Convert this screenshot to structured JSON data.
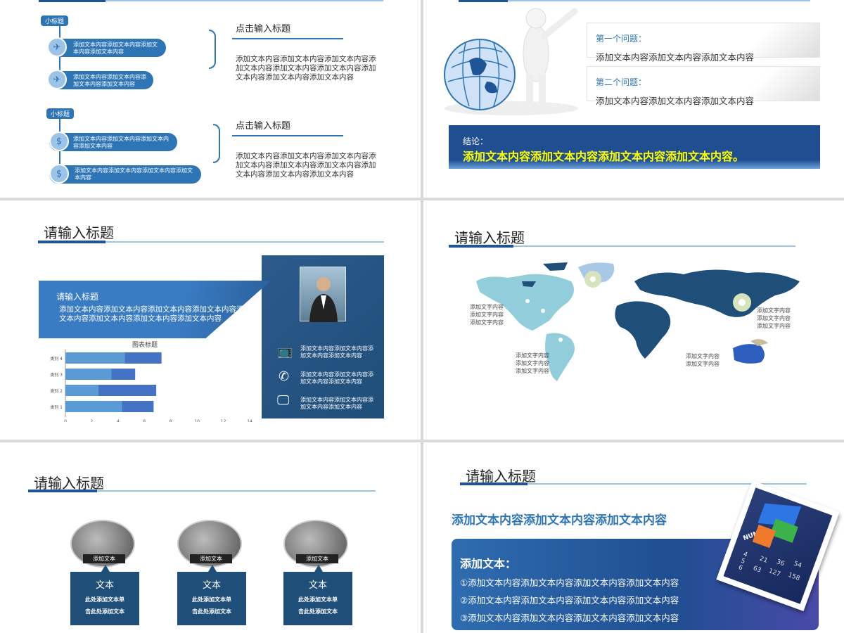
{
  "s1": {
    "groups": [
      {
        "tag": "小标题",
        "items": [
          {
            "icon": "airplane-icon",
            "glyph": "✈",
            "text": "添加文本内容添加文本内容添加文本内容添加文本内容"
          },
          {
            "icon": "airplane-icon",
            "glyph": "✈",
            "text": "添加文本内容添加文本内容添加文本内容添加文本内容"
          }
        ],
        "heading": "点击输入标题",
        "body": "添加文本内容添加文本内容添加文本内容添加文本内容添加文本内容添加文本内容添加文本内容添加文本内容添加文本内容"
      },
      {
        "tag": "小标题",
        "items": [
          {
            "icon": "dollar-doc-icon",
            "glyph": "$",
            "text": "添加文本内容添加文本内容添加文本内容添加文本内容"
          },
          {
            "icon": "dollar-doc-icon",
            "glyph": "$",
            "text": "添加文本内容添加文本内容添加文本内容添加文本内容"
          }
        ],
        "heading": "点击输入标题",
        "body": "添加文本内容添加文本内容添加文本内容添加文本内容添加文本内容添加文本内容添加文本内容添加文本内容添加文本内容"
      }
    ]
  },
  "s2": {
    "q1_title": "第一个问题：",
    "q1_body": "添加文本内容添加文本内容添加文本内容",
    "q2_title": "第二个问题：",
    "q2_body": "添加文本内容添加文本内容添加文本内容",
    "conclusion_label": "结论：",
    "conclusion_text": "添加文本内容添加文本内容添加文本内容添加文本内容。"
  },
  "s3": {
    "title": "请输入标题",
    "band_title": "请输入标题",
    "band_body": "添加文本内容添加文本内容添加文本内容添加文本内容添加文本内容添加文本内容添加文本内容添加文本内容",
    "chart_title": "图表标题",
    "features": [
      {
        "icon": "tv-icon",
        "glyph": "📺",
        "text": "添加文本内容添加文本内容添加文本内容添加文本内容"
      },
      {
        "icon": "phone-icon",
        "glyph": "✆",
        "text": "添加文本内容添加文本内容添加文本内容添加文本内容"
      },
      {
        "icon": "monitor-icon",
        "glyph": "🖵",
        "text": "添加文本内容添加文本内容添加文本内容添加文本内容"
      }
    ]
  },
  "chart_data": {
    "type": "bar",
    "title": "图表标题",
    "categories": [
      "类别 4",
      "类别 3",
      "类别 2",
      "类别 1"
    ],
    "series": [
      {
        "values": [
          4.5,
          3.5,
          2.5,
          4.3
        ],
        "color": "#5b9bd5"
      },
      {
        "values": [
          2.8,
          1.8,
          4.4,
          2.4
        ],
        "color": "#4472c4"
      }
    ],
    "xlim": [
      0,
      14
    ],
    "xticks": [
      "0",
      "2",
      "4",
      "6",
      "8",
      "10",
      "12",
      "14"
    ],
    "orientation": "horizontal",
    "stacked": true
  },
  "s4": {
    "title": "请输入标题",
    "labels": [
      "添加文字内容\n添加文字内容\n添加文字内容",
      "添加文字内容\n添加文字内容\n添加文字内容",
      "添加文字内容\n添加文字内容\n添加文字内容",
      "添加文字内容\n添加文字内容"
    ]
  },
  "s5": {
    "title": "请输入标题",
    "cards": [
      {
        "caption": "添加文本",
        "title": "文本",
        "sub1": "此处添加文本单",
        "sub2": "击此处添加文本"
      },
      {
        "caption": "添加文本",
        "title": "文本",
        "sub1": "此处添加文本单",
        "sub2": "击此处添加文本"
      },
      {
        "caption": "添加文本",
        "title": "文本",
        "sub1": "此处添加文本单",
        "sub2": "击此处添加文本"
      }
    ]
  },
  "s6": {
    "title": "请输入标题",
    "subtitle": "添加文本内容添加文本内容添加文本内容",
    "box_title": "添加文本：",
    "lines": [
      "①添加文本内容添加文本内容添加文本内容添加文本内容",
      "②添加文本内容添加文本内容添加文本内容添加文本内容",
      "③添加文本内容添加文本内容添加文本内容添加文本内容"
    ],
    "num_label": "NUM",
    "nums": [
      "21",
      "36",
      "54",
      "63",
      "127",
      "158",
      "4",
      "5",
      "6"
    ]
  },
  "colors": {
    "brand_dark": "#1f4e79",
    "brand": "#2e75b6",
    "light": "#9dc3e6",
    "accent_yellow": "#ffff00"
  }
}
